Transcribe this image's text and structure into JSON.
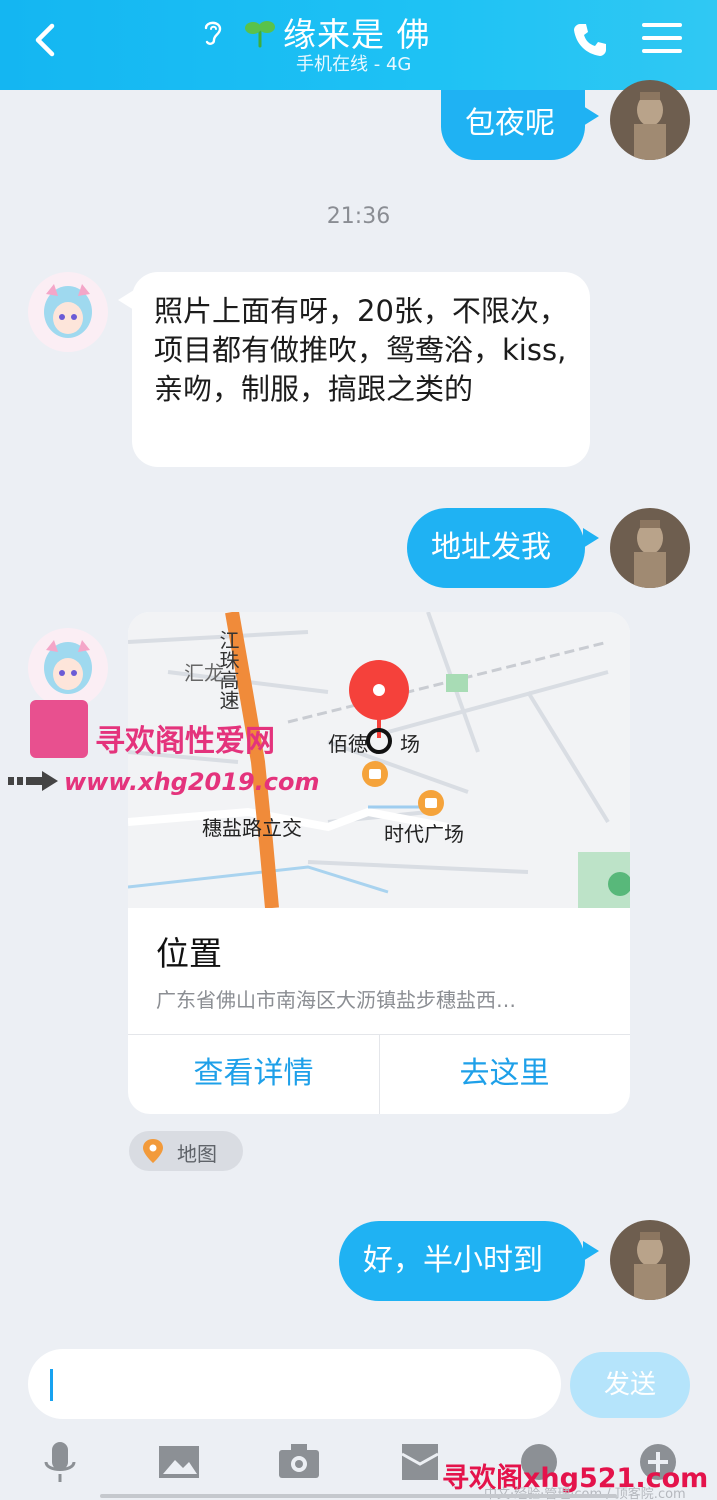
{
  "header": {
    "title": "缘来是 佛",
    "status": "手机在线 - 4G"
  },
  "messages": {
    "m1": "包夜呢",
    "time": "21:36",
    "m2": "照片上面有呀，20张，不限次，项目都有做推吹，鸳鸯浴，kiss,亲吻，制服，搞跟之类的",
    "m3": "地址发我",
    "m4": "好，半小时到"
  },
  "location_card": {
    "map_labels": {
      "road_left": "江珠高速",
      "hui_long": "汇龙",
      "bai_plaza": "佰徳",
      "chang": "场",
      "sui_yan": "穗盐路立交",
      "times_square": "时代广场"
    },
    "title": "位置",
    "address": "广东省佛山市南海区大沥镇盐步穗盐西…",
    "view_details": "查看详情",
    "go_here": "去这里"
  },
  "map_chip": {
    "label": "地图"
  },
  "watermark": {
    "text": "寻欢阁性爱网",
    "url": "www.xhg2019.com",
    "bottom": "寻欢阁xhg521.com",
    "bottom_sub": "中文·经验·管理·com / 顶客院.com"
  },
  "input": {
    "value": "",
    "send_label": "发送"
  },
  "colors": {
    "header_bg": "#1ec2f4",
    "bubble_out": "#1fb2f3",
    "accent_link": "#1ea0e9",
    "pin": "#f5413b"
  }
}
